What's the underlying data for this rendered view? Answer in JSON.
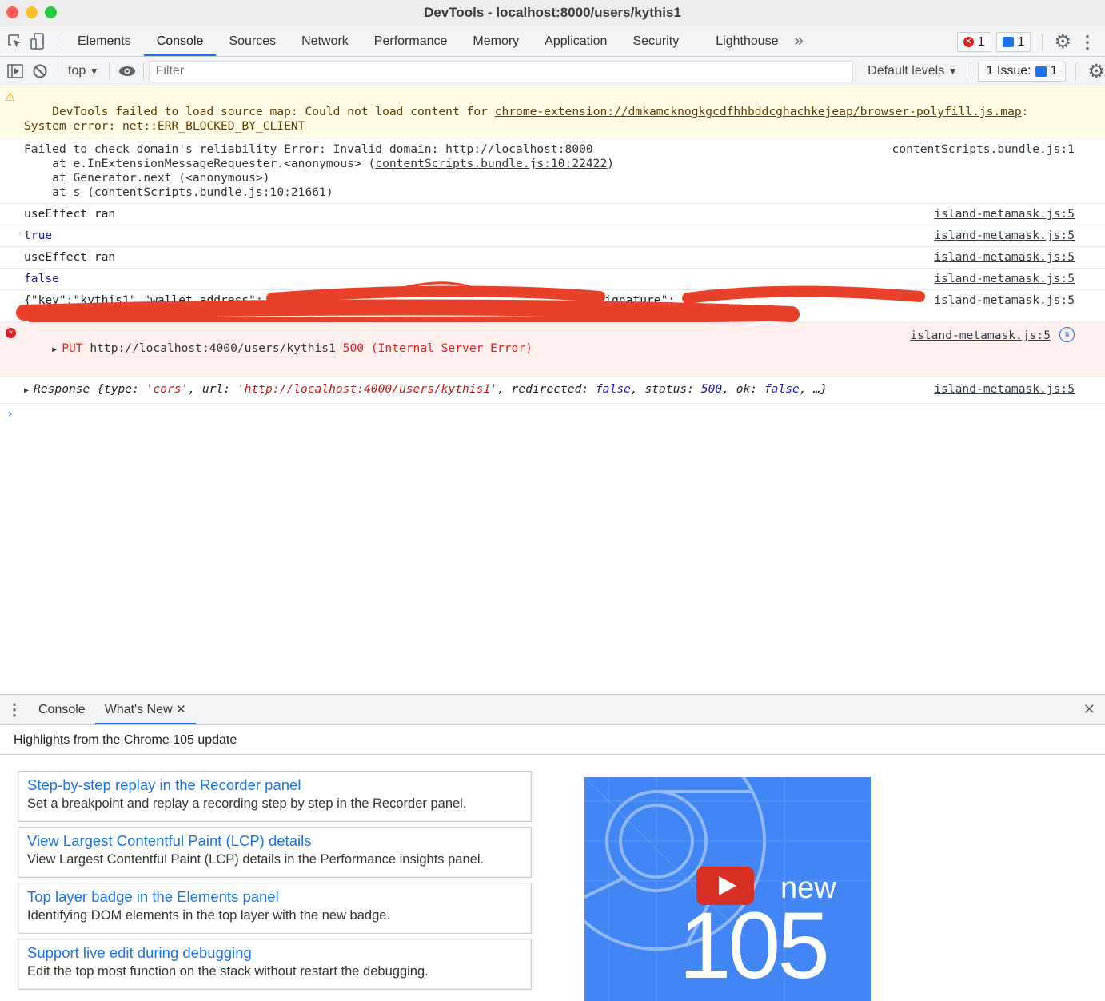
{
  "window": {
    "title": "DevTools - localhost:8000/users/kythis1"
  },
  "tabs": [
    "Elements",
    "Console",
    "Sources",
    "Network",
    "Performance",
    "Memory",
    "Application",
    "Security",
    "Lighthouse"
  ],
  "active_tab": "Console",
  "counts": {
    "errors": "1",
    "messages": "1"
  },
  "toolbar": {
    "context": "top",
    "filter_placeholder": "Filter",
    "levels": "Default levels",
    "issues_label": "1 Issue:",
    "issues_count": "1"
  },
  "messages": {
    "warning": {
      "text1": "DevTools failed to load source map: Could not load content for ",
      "link": "chrome-extension://dmkamcknogkgcdfhhbddcghachkejeap/browser-polyfill.js.map",
      "text2": ":",
      "line2": "System error: net::ERR_BLOCKED_BY_CLIENT"
    },
    "reliability": {
      "text": "Failed to check domain's reliability Error: Invalid domain: ",
      "link": "http://localhost:8000",
      "src": "contentScripts.bundle.js:1",
      "stack1a": "    at e.InExtensionMessageRequester.<anonymous> (",
      "stack1link": "contentScripts.bundle.js:10:22422",
      "stack1b": ")",
      "stack2": "    at Generator.next (<anonymous>)",
      "stack3a": "    at s (",
      "stack3link": "contentScripts.bundle.js:10:21661",
      "stack3b": ")"
    },
    "log1": {
      "text": "useEffect ran",
      "src": "island-metamask.js:5"
    },
    "log2": {
      "text": "true",
      "src": "island-metamask.js:5"
    },
    "log3": {
      "text": "useEffect ran",
      "src": "island-metamask.js:5"
    },
    "log4": {
      "text": "false",
      "src": "island-metamask.js:5"
    },
    "log5": {
      "text_a": "{\"key\":\"kythis1\",\"wallet_address\":",
      "text_b": "\"signature\":",
      "src": "island-metamask.js:5"
    },
    "error": {
      "method": "PUT ",
      "url": "http://localhost:4000/users/kythis1",
      "status": " 500 (Internal Server Error)",
      "src": "island-metamask.js:5"
    },
    "response": {
      "p1": "Response {type: ",
      "v1": "'cors'",
      "p2": ", url: ",
      "v2": "'http://localhost:4000/users/kythis1'",
      "p3": ", redirected: ",
      "v3": "false",
      "p4": ", status: ",
      "v4": "500",
      "p5": ", ok: ",
      "v5": "false",
      "p6": ", …}",
      "src": "island-metamask.js:5"
    }
  },
  "drawer": {
    "tabs": [
      "Console",
      "What's New"
    ],
    "highlights": "Highlights from the Chrome 105 update",
    "cards": [
      {
        "title": "Step-by-step replay in the Recorder panel",
        "desc": "Set a breakpoint and replay a recording step by step in the Recorder panel."
      },
      {
        "title": "View Largest Contentful Paint (LCP) details",
        "desc": "View Largest Contentful Paint (LCP) details in the Performance insights panel."
      },
      {
        "title": "Top layer badge in the Elements panel",
        "desc": "Identifying DOM elements in the top layer with the new badge."
      },
      {
        "title": "Support live edit during debugging",
        "desc": "Edit the top most function on the stack without restart the debugging."
      }
    ],
    "video": {
      "new": "new",
      "version": "105"
    }
  },
  "colors": {
    "accent": "#1a73e8",
    "error": "#e41e1e",
    "warning_bg": "#fffbe5",
    "redaction": "#e8412b",
    "video_bg": "#4285f4"
  }
}
